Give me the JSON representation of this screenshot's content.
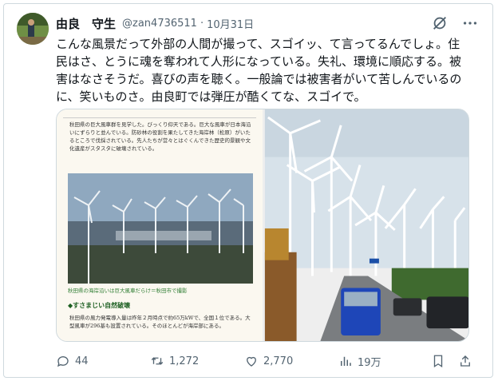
{
  "author": {
    "display_name": "由良　守生",
    "handle": "@zan4736511",
    "date": "10月31日"
  },
  "tweet_text": "こんな風景だって外部の人間が撮って、スゴイッ、て言ってるんでしょ。住民はさ、とうに魂を奪われて人形になっている。失礼、環境に順応する。被害はなさそうだ。喜びの声を聴く。一般論では被害者がいて苦しんでいるのに、笑いものさ。由良町では弾圧が酷くてな、スゴイで。",
  "media_left": {
    "paragraph1": "秋田県の巨大風車群を見学した。びっくり仰天である。巨大な風車が日本海沿いにずらりと並んでいる。防砂林の役割を果たしてきた海岸林（松原）がいたるところで伐採されている。先人たちが営々とはぐくんできた歴史的景観や文化遺産がスタスタに破壊されている。",
    "caption": "秋田県の海岸沿いは巨大風車だらけ＝秋田市で撮影",
    "heading": "◆すさまじい自然破壊",
    "paragraph2": "秋田県の風力発電導入量は昨年２月時点で約65万kWで、全国１位である。大型風車が296基も設置されている。そのほとんどが海岸部にある。"
  },
  "actions": {
    "replies": "44",
    "retweets": "1,272",
    "likes": "2,770",
    "views": "19万"
  },
  "colors": {
    "text": "#0f1419",
    "secondary": "#536471",
    "border": "#cfd9de",
    "accent_green": "#2e7d32"
  }
}
